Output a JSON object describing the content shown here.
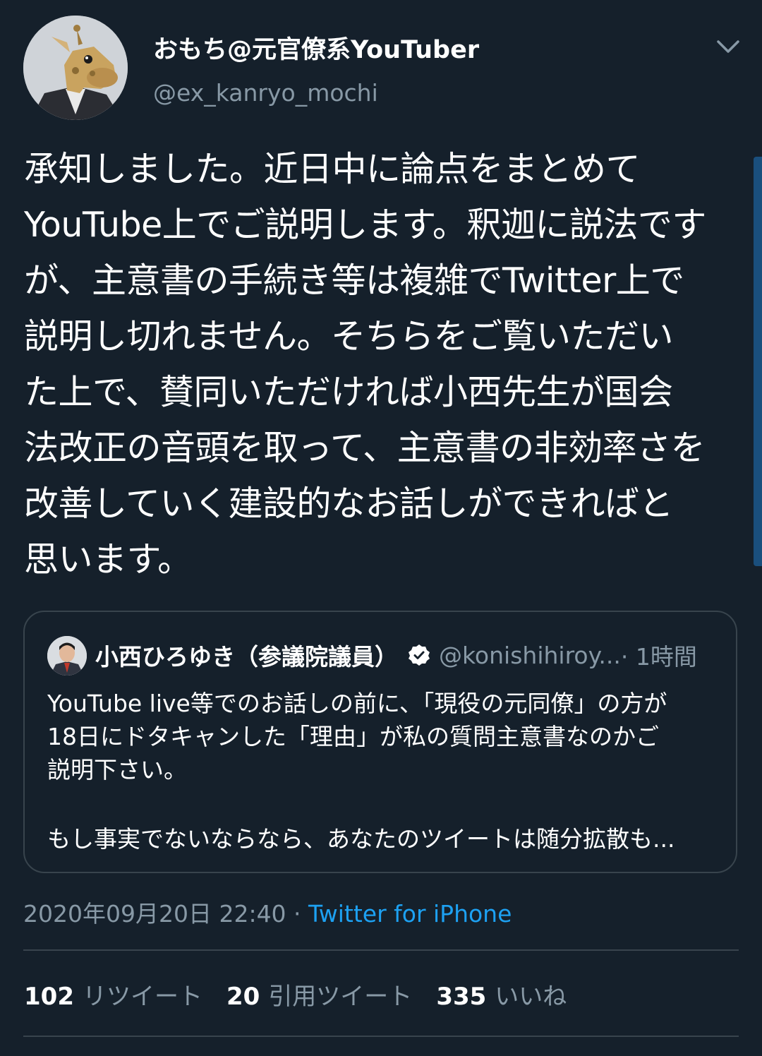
{
  "author": {
    "display_name": "おもち@元官僚系YouTuber",
    "handle": "@ex_kanryo_mochi"
  },
  "tweet": {
    "text": "承知しました。近日中に論点をまとめて\nYouTube上でご説明します。釈迦に説法です\nが、主意書の手続き等は複雑でTwitter上で\n説明し切れません。そちらをご覧いただい\nた上で、賛同いただければ小西先生が国会\n法改正の音頭を取って、主意書の非効率さを\n改善していく建設的なお話しができればと\n思います。"
  },
  "quoted_tweet": {
    "display_name": "小西ひろゆき（参議院議員）",
    "handle": "@konishihiroy...",
    "time": " · 1時間",
    "text": "YouTube live等でのお話しの前に、「現役の元同僚」の方が\n18日にドタキャンした「理由」が私の質問主意書なのかご\n説明下さい。",
    "text_continued": "もし事実でないならなら、あなたのツイートは随分拡散も..."
  },
  "meta": {
    "timestamp": "2020年09月20日 22:40",
    "separator": " · ",
    "source": "Twitter for iPhone"
  },
  "stats": {
    "retweets": "102",
    "retweets_label": "リツイート",
    "quotes": "20",
    "quotes_label": "引用ツイート",
    "likes": "335",
    "likes_label": "いいね"
  },
  "colors": {
    "background": "#15202b",
    "secondary_text": "#8899a6",
    "accent": "#1da1f2",
    "border": "#38444d"
  },
  "icons": {
    "menu": "chevron-down-icon",
    "verified": "verified-badge-icon"
  }
}
